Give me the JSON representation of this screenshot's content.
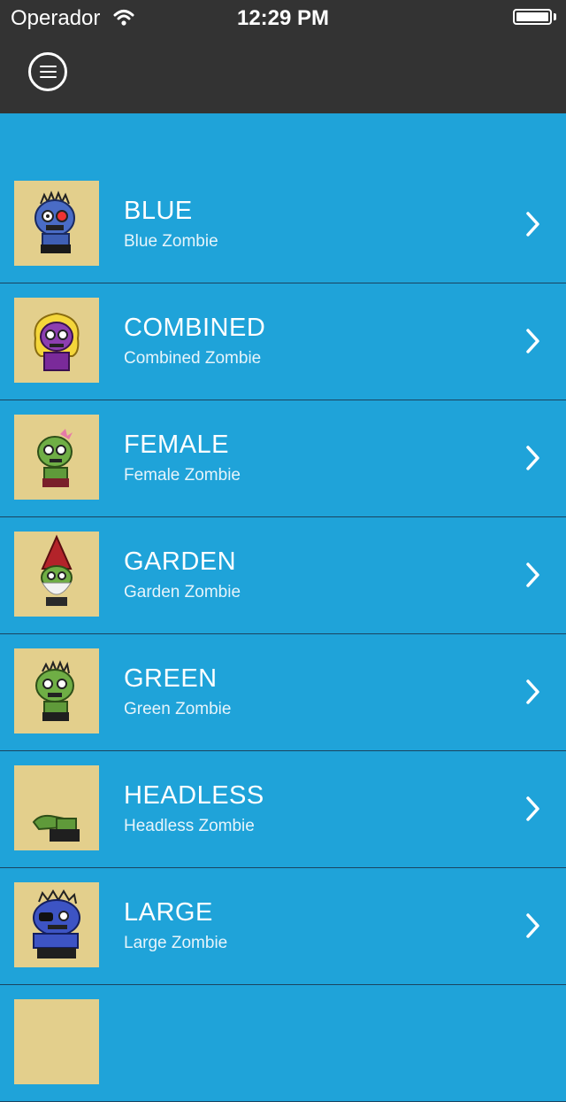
{
  "status_bar": {
    "carrier": "Operador",
    "time": "12:29 PM"
  },
  "nav": {
    "menu_icon": "menu-icon"
  },
  "colors": {
    "bar_bg": "#333333",
    "list_bg": "#1fa3d9",
    "thumb_bg": "#e3cf8c"
  },
  "zombies": [
    {
      "title": "BLUE",
      "subtitle": "Blue Zombie"
    },
    {
      "title": "COMBINED",
      "subtitle": "Combined Zombie"
    },
    {
      "title": "FEMALE",
      "subtitle": "Female Zombie"
    },
    {
      "title": "GARDEN",
      "subtitle": "Garden Zombie"
    },
    {
      "title": "GREEN",
      "subtitle": "Green Zombie"
    },
    {
      "title": "HEADLESS",
      "subtitle": "Headless Zombie"
    },
    {
      "title": "LARGE",
      "subtitle": "Large Zombie"
    }
  ]
}
